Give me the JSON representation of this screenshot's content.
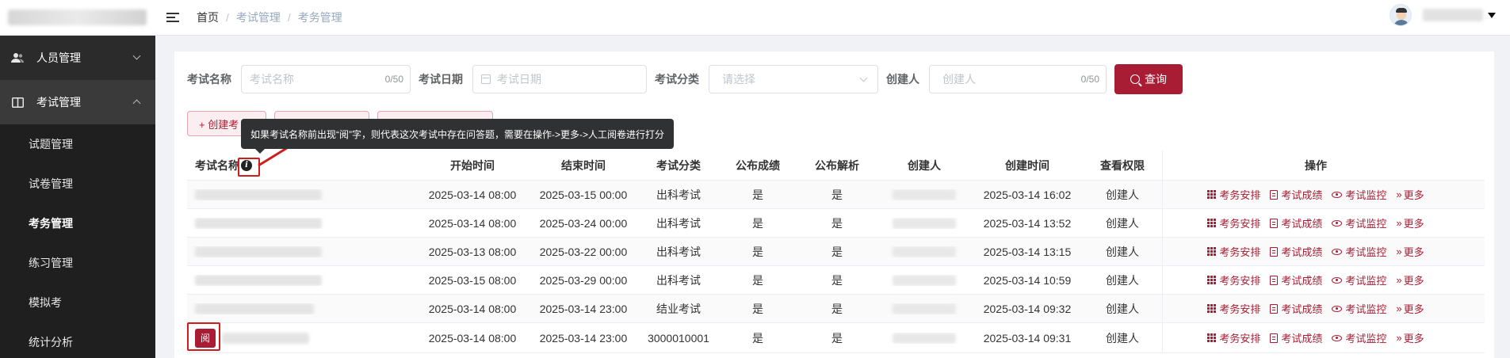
{
  "header": {
    "breadcrumb": [
      {
        "label": "首页"
      },
      {
        "label": "考试管理"
      },
      {
        "label": "考务管理"
      }
    ]
  },
  "sidebar": {
    "groups": [
      {
        "label": "人员管理",
        "icon": "user-icon",
        "open": false
      },
      {
        "label": "考试管理",
        "icon": "book-icon",
        "open": true
      }
    ],
    "sub_items": [
      {
        "label": "试题管理"
      },
      {
        "label": "试卷管理"
      },
      {
        "label": "考务管理",
        "active": true
      },
      {
        "label": "练习管理"
      },
      {
        "label": "模拟考"
      },
      {
        "label": "统计分析"
      }
    ]
  },
  "filters": {
    "exam_name": {
      "label": "考试名称",
      "placeholder": "考试名称",
      "count": "0/50"
    },
    "exam_date": {
      "label": "考试日期",
      "placeholder": "考试日期"
    },
    "exam_category": {
      "label": "考试分类",
      "placeholder": "请选择"
    },
    "creator": {
      "label": "创建人",
      "placeholder": "创建人",
      "count": "0/50"
    },
    "query_label": "查询"
  },
  "actions": {
    "create_label": "+ 创建考"
  },
  "tooltip": {
    "text": "如果考试名称前出现“阅”字，则代表这次考试中存在问答题，需要在操作->更多->人工阅卷进行打分"
  },
  "table": {
    "headers": {
      "name": "考试名称",
      "start": "开始时间",
      "end": "结束时间",
      "category": "考试分类",
      "publish_score": "公布成绩",
      "publish_analysis": "公布解析",
      "creator": "创建人",
      "created": "创建时间",
      "permission": "查看权限",
      "operation": "操作"
    },
    "rows": [
      {
        "start": "2025-03-14 08:00",
        "end": "2025-03-15 00:00",
        "category": "出科考试",
        "publish_score": "是",
        "publish_analysis": "是",
        "created": "2025-03-14 16:02",
        "permission": "创建人"
      },
      {
        "start": "2025-03-14 08:00",
        "end": "2025-03-24 00:00",
        "category": "出科考试",
        "publish_score": "是",
        "publish_analysis": "是",
        "created": "2025-03-14 13:52",
        "permission": "创建人"
      },
      {
        "start": "2025-03-13 08:00",
        "end": "2025-03-22 00:00",
        "category": "出科考试",
        "publish_score": "是",
        "publish_analysis": "是",
        "created": "2025-03-14 13:15",
        "permission": "创建人"
      },
      {
        "start": "2025-03-15 08:00",
        "end": "2025-03-29 00:00",
        "category": "出科考试",
        "publish_score": "是",
        "publish_analysis": "是",
        "created": "2025-03-14 10:59",
        "permission": "创建人"
      },
      {
        "start": "2025-03-14 08:00",
        "end": "2025-03-14 23:00",
        "category": "结业考试",
        "publish_score": "是",
        "publish_analysis": "是",
        "created": "2025-03-14 09:32",
        "permission": "创建人"
      },
      {
        "start": "2025-03-14 08:00",
        "end": "2025-03-14 23:00",
        "category": "3000010001",
        "publish_score": "是",
        "publish_analysis": "是",
        "created": "2025-03-14 09:31",
        "permission": "创建人",
        "tag": "阅"
      }
    ],
    "operations": {
      "schedule": "考务安排",
      "scores": "考试成绩",
      "monitor": "考试监控",
      "more": "更多"
    }
  },
  "colors": {
    "brand": "#a81d33",
    "sidebar_bg": "#2b2b2b",
    "highlight_box": "#d01c1c"
  }
}
